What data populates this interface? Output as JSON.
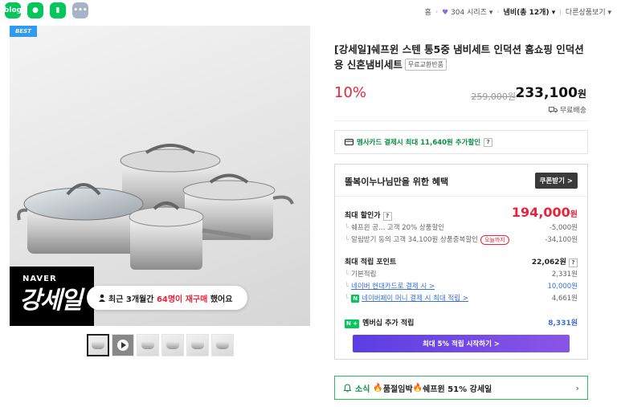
{
  "topbar": {
    "app_icons": [
      {
        "icon": "blog-icon",
        "glyph": "blog"
      },
      {
        "icon": "talk-icon",
        "glyph": "●"
      },
      {
        "icon": "bookmark-icon",
        "glyph": "▮"
      },
      {
        "icon": "more-icon",
        "glyph": "•••"
      }
    ],
    "breadcrumb": {
      "home": "홈",
      "series": "304 시리즈",
      "category": "냄비(총 12개)",
      "other": "다른상품보기"
    }
  },
  "product": {
    "badge": "BEST",
    "banner_small": "NAVER",
    "banner_big": "강세일",
    "repurchase": {
      "prefix": "최근 3개월간",
      "highlight": "64명이 재구매",
      "suffix": "했어요"
    },
    "title": "[강세일]쉐프윈 스텐 통5중 냄비세트 인덕션 홈쇼핑 인덕션용 신혼냄비세트",
    "title_badge": "무료교환반품",
    "discount": "10%",
    "original_price": "259,000원",
    "sale_price": "233,100",
    "sale_price_unit": "원",
    "shipping": "무료배송"
  },
  "card_promo": "멤사카드 결제시 최대 11,640원 추가할인",
  "benefit": {
    "title": "똘복이누나님만을 위한 혜택",
    "coupon_button": "쿠폰받기 >",
    "max_discount_label": "최대 할인가",
    "max_discount_value": "194,000",
    "max_discount_unit": "원",
    "discount_rows": [
      {
        "label": "쉐프윈 공... 고객 20% 상품할인",
        "value": "-5,000원"
      },
      {
        "label": "알림받기 동의 고객 34,100원 상품중복할인",
        "tag": "오늘까지",
        "value": "-34,100원"
      }
    ],
    "points_label": "최대 적립 포인트",
    "points_value": "22,062원",
    "point_rows": [
      {
        "label": "기본적립",
        "value": "2,331원"
      },
      {
        "label": "네이버 현대카드로 결제 시 >",
        "value": "10,000원"
      },
      {
        "label": "네이버페이 머니 결제 시 최대 적립 >",
        "value": "4,661원"
      }
    ],
    "member_label": "멤버십 추가 적립",
    "member_value": "8,331원",
    "member_badge": "N +",
    "cta": "최대 5% 적립 시작하기 >"
  },
  "news": {
    "label": "소식",
    "text_1": "품절임박",
    "text_2": "쉐프윈 51% 강세일"
  },
  "colors": {
    "naver_green": "#03c75a",
    "sale_red": "#e8233a",
    "link_blue": "#3a6fd8",
    "cta_purple": "#5b3ee4"
  }
}
